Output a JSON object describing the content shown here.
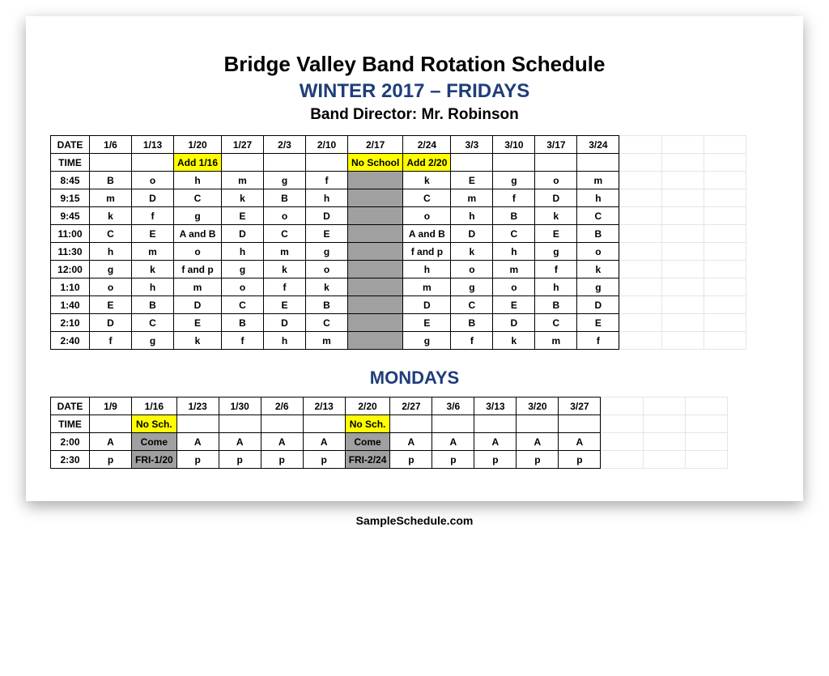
{
  "title": "Bridge Valley Band  Rotation Schedule",
  "subtitle": "WINTER 2017 – FRIDAYS",
  "director": "Band Director: Mr. Robinson",
  "footer": "SampleSchedule.com",
  "fridays": {
    "header_row1_label": "DATE",
    "dates": [
      "1/6",
      "1/13",
      "1/20",
      "1/27",
      "2/3",
      "2/10",
      "2/17",
      "2/24",
      "3/3",
      "3/10",
      "3/17",
      "3/24"
    ],
    "header_row2_label": "TIME",
    "time_row": [
      "",
      "",
      "Add 1/16",
      "",
      "",
      "",
      "No School",
      "Add 2/20",
      "",
      "",
      "",
      ""
    ],
    "time_row_yellow_cols": [
      2,
      6,
      7
    ],
    "rows": [
      {
        "label": "8:45",
        "cells": [
          "B",
          "o",
          "h",
          "m",
          "g",
          "f",
          "",
          "k",
          "E",
          "g",
          "o",
          "m"
        ]
      },
      {
        "label": "9:15",
        "cells": [
          "m",
          "D",
          "C",
          "k",
          "B",
          "h",
          "",
          "C",
          "m",
          "f",
          "D",
          "h"
        ]
      },
      {
        "label": "9:45",
        "cells": [
          "k",
          "f",
          "g",
          "E",
          "o",
          "D",
          "",
          "o",
          "h",
          "B",
          "k",
          "C"
        ]
      },
      {
        "label": "11:00",
        "cells": [
          "C",
          "E",
          "A and B",
          "D",
          "C",
          "E",
          "",
          "A and B",
          "D",
          "C",
          "E",
          "B"
        ],
        "tall": true
      },
      {
        "label": "11:30",
        "cells": [
          "h",
          "m",
          "o",
          "h",
          "m",
          "g",
          "",
          "f and p",
          "k",
          "h",
          "g",
          "o"
        ],
        "tall": true
      },
      {
        "label": "12:00",
        "cells": [
          "g",
          "k",
          "f and p",
          "g",
          "k",
          "o",
          "",
          "h",
          "o",
          "m",
          "f",
          "k"
        ],
        "tall": true
      },
      {
        "label": "1:10",
        "cells": [
          "o",
          "h",
          "m",
          "o",
          "f",
          "k",
          "",
          "m",
          "g",
          "o",
          "h",
          "g"
        ],
        "tall": true
      },
      {
        "label": "1:40",
        "cells": [
          "E",
          "B",
          "D",
          "C",
          "E",
          "B",
          "",
          "D",
          "C",
          "E",
          "B",
          "D"
        ],
        "tall": true
      },
      {
        "label": "2:10",
        "cells": [
          "D",
          "C",
          "E",
          "B",
          "D",
          "C",
          "",
          "E",
          "B",
          "D",
          "C",
          "E"
        ],
        "tall": true
      },
      {
        "label": "2:40",
        "cells": [
          "f",
          "g",
          "k",
          "f",
          "h",
          "m",
          "",
          "g",
          "f",
          "k",
          "m",
          "f"
        ],
        "tall": true
      }
    ],
    "grey_col": 6
  },
  "mondays": {
    "section_title": "MONDAYS",
    "header_row1_label": "DATE",
    "dates": [
      "1/9",
      "1/16",
      "1/23",
      "1/30",
      "2/6",
      "2/13",
      "2/20",
      "2/27",
      "3/6",
      "3/13",
      "3/20",
      "3/27"
    ],
    "header_row2_label": "TIME",
    "time_row": [
      "",
      "No Sch.",
      "",
      "",
      "",
      "",
      "No Sch.",
      "",
      "",
      "",
      "",
      ""
    ],
    "time_row_yellow_cols": [
      1,
      6
    ],
    "rows": [
      {
        "label": "2:00",
        "cells": [
          "A",
          "Come",
          "A",
          "A",
          "A",
          "A",
          "Come",
          "A",
          "A",
          "A",
          "A",
          "A"
        ]
      },
      {
        "label": "2:30",
        "cells": [
          "p",
          "FRI-1/20",
          "p",
          "p",
          "p",
          "p",
          "FRI-2/24",
          "p",
          "p",
          "p",
          "p",
          "p"
        ]
      }
    ],
    "grey_cols": [
      1,
      6
    ]
  }
}
